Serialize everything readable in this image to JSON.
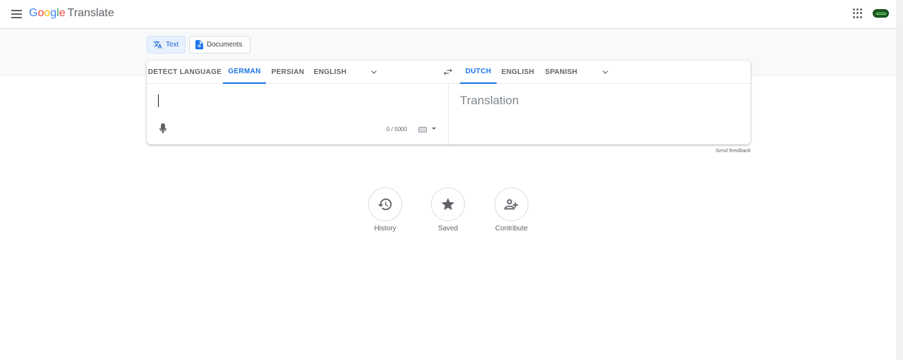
{
  "header": {
    "logo_letters": [
      {
        "char": "G",
        "color": "#4285f4"
      },
      {
        "char": "o",
        "color": "#ea4335"
      },
      {
        "char": "o",
        "color": "#fbbc05"
      },
      {
        "char": "g",
        "color": "#4285f4"
      },
      {
        "char": "l",
        "color": "#34a853"
      },
      {
        "char": "e",
        "color": "#ea4335"
      }
    ],
    "logo_word": "Translate",
    "menu_icon": "hamburger-menu-icon",
    "apps_icon": "apps-grid-icon"
  },
  "modes": {
    "text_label": "Text",
    "documents_label": "Documents"
  },
  "source_languages": {
    "detect": "DETECT LANGUAGE",
    "german": "GERMAN",
    "persian": "PERSIAN",
    "english": "ENGLISH",
    "active": "GERMAN"
  },
  "target_languages": {
    "dutch": "DUTCH",
    "english": "ENGLISH",
    "spanish": "SPANISH",
    "active": "DUTCH"
  },
  "source": {
    "value": "",
    "char_count": "0 / 5000"
  },
  "target": {
    "placeholder": "Translation"
  },
  "feedback_label": "Send feedback",
  "actions": {
    "history": "History",
    "saved": "Saved",
    "contribute": "Contribute"
  },
  "colors": {
    "accent": "#1a73e8",
    "active_mode_bg": "#e8f0fe",
    "band": "#f8f9fa"
  }
}
